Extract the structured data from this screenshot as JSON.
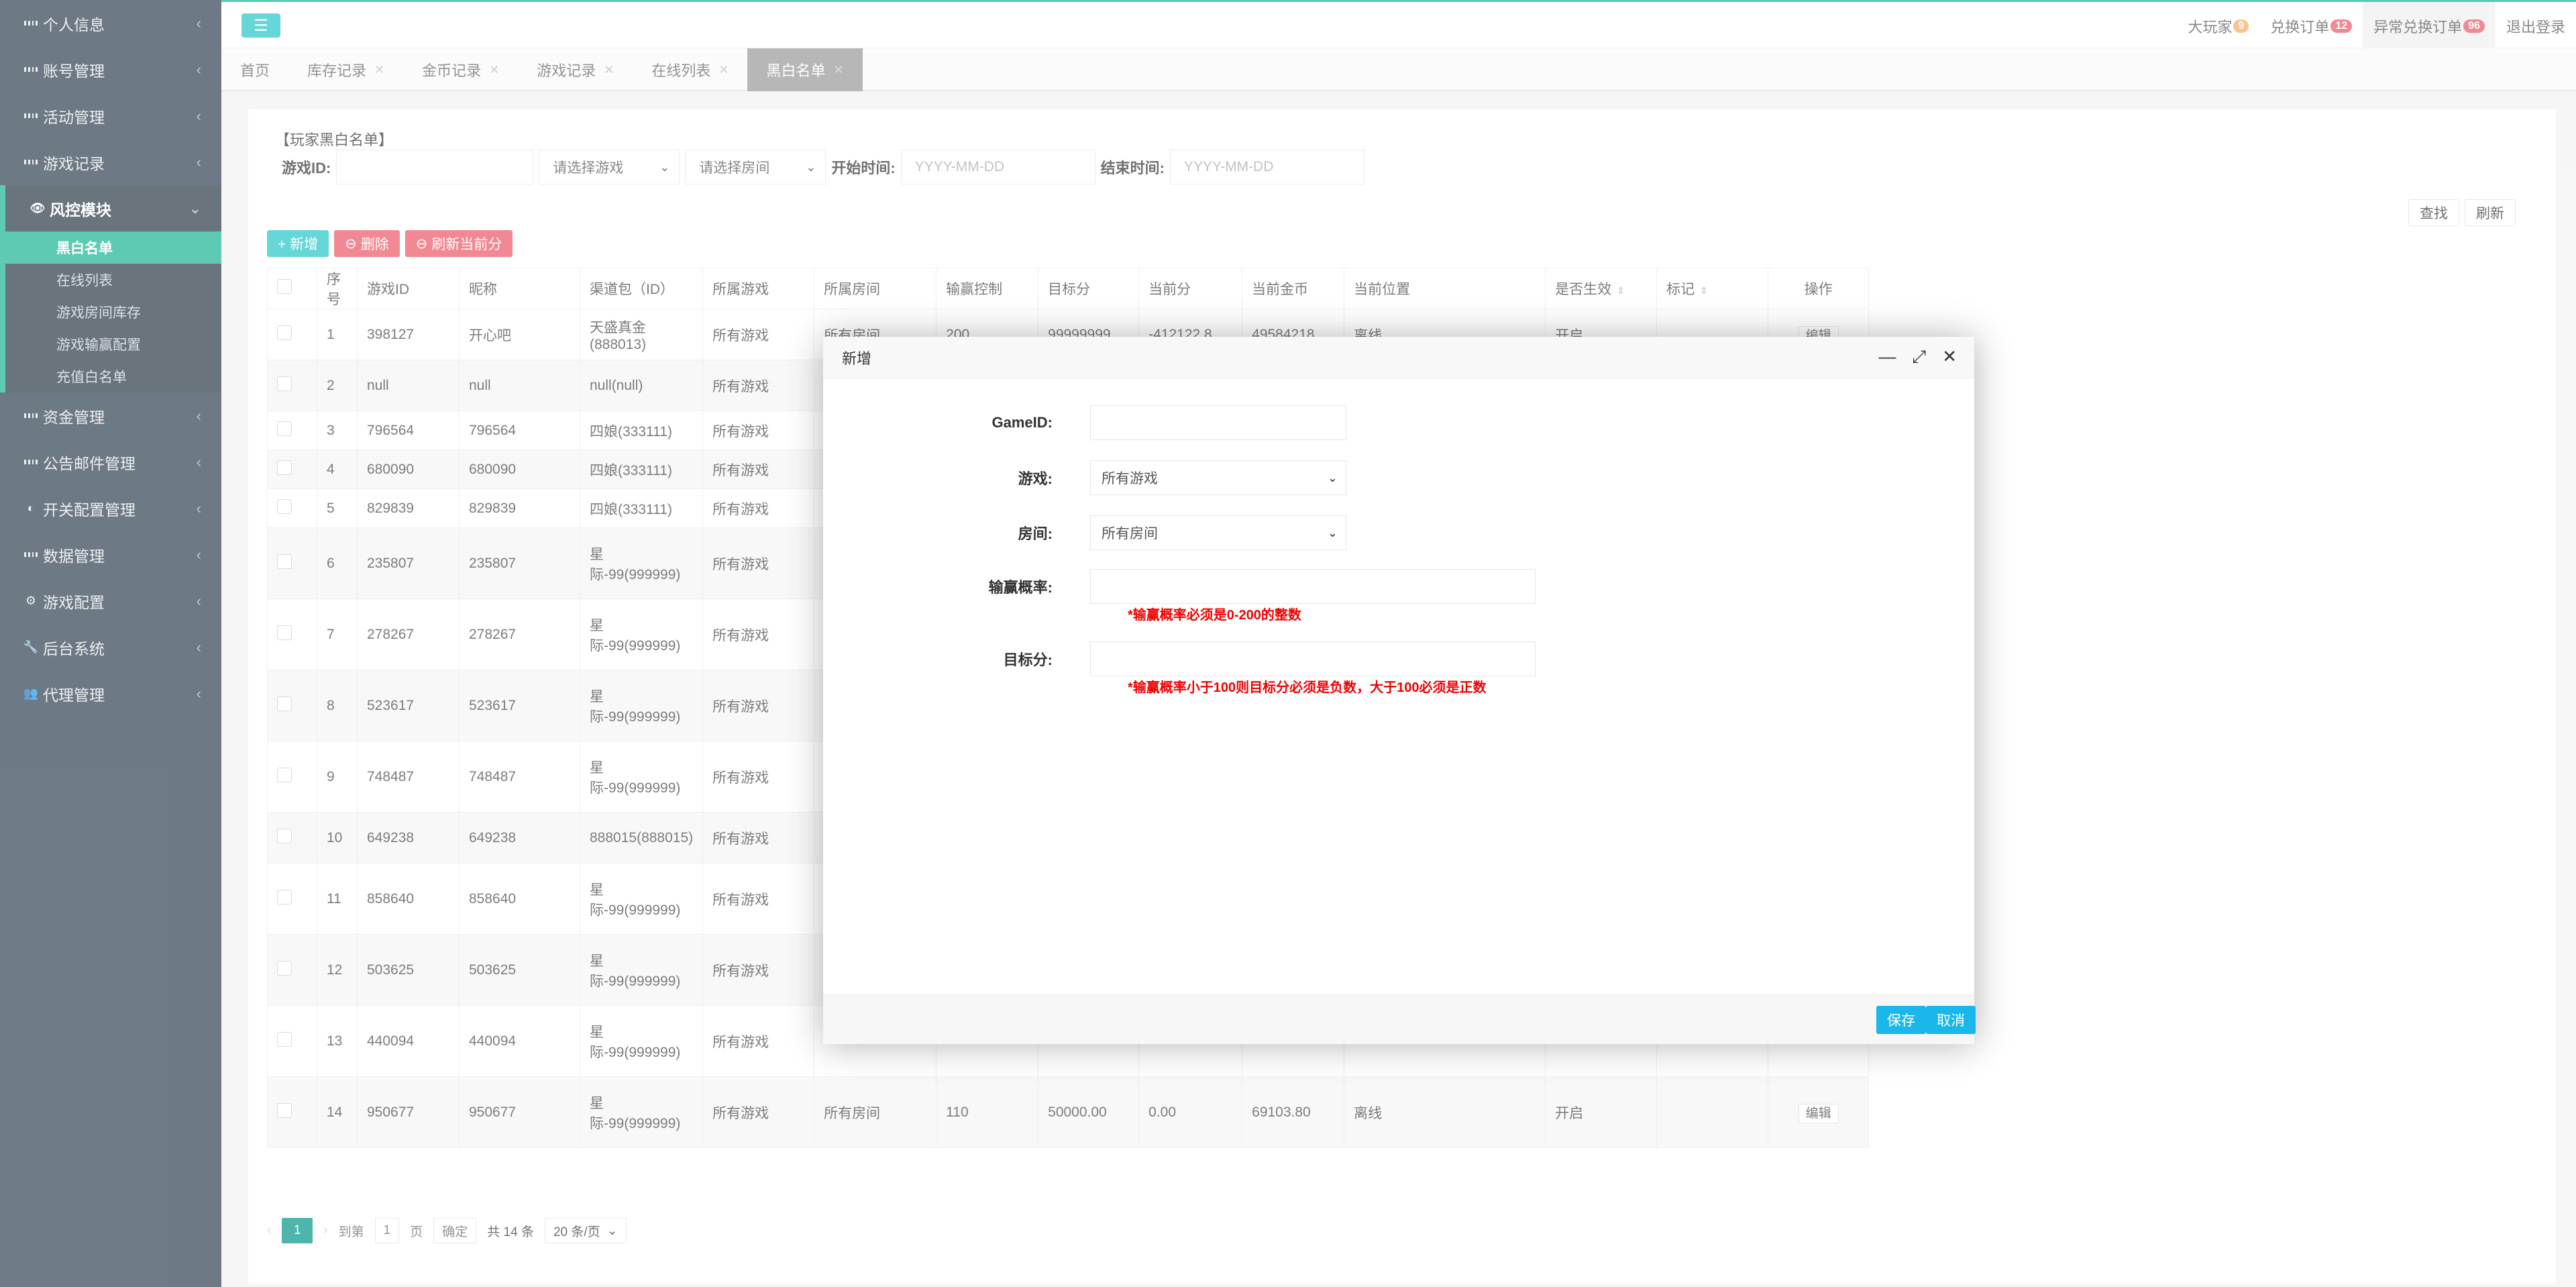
{
  "sidebar": {
    "items": [
      {
        "label": "个人信息"
      },
      {
        "label": "账号管理"
      },
      {
        "label": "活动管理"
      },
      {
        "label": "游戏记录"
      },
      {
        "label": "风控模块"
      },
      {
        "label": "资金管理"
      },
      {
        "label": "公告邮件管理"
      },
      {
        "label": "开关配置管理"
      },
      {
        "label": "数据管理"
      },
      {
        "label": "游戏配置"
      },
      {
        "label": "后台系统"
      },
      {
        "label": "代理管理"
      }
    ],
    "sub_items": [
      {
        "label": "黑白名单"
      },
      {
        "label": "在线列表"
      },
      {
        "label": "游戏房间库存"
      },
      {
        "label": "游戏输赢配置"
      },
      {
        "label": "充值白名单"
      }
    ]
  },
  "topbar": {
    "menu_icon": "☰",
    "links": [
      {
        "label": "大玩家",
        "badge": "9"
      },
      {
        "label": "兑换订单",
        "badge": "12"
      },
      {
        "label": "异常兑换订单",
        "badge": "96"
      },
      {
        "label": "退出登录"
      }
    ]
  },
  "tabs": [
    {
      "label": "首页"
    },
    {
      "label": "库存记录"
    },
    {
      "label": "金币记录"
    },
    {
      "label": "游戏记录"
    },
    {
      "label": "在线列表"
    },
    {
      "label": "黑白名单"
    }
  ],
  "panel": {
    "title": "【玩家黑白名单】",
    "filters": {
      "game_id_label": "游戏ID:",
      "game_select": "请选择游戏",
      "room_select": "请选择房间",
      "start_label": "开始时间:",
      "start_placeholder": "YYYY-MM-DD",
      "end_label": "结束时间:",
      "end_placeholder": "YYYY-MM-DD"
    },
    "search_label": "查找",
    "refresh_label": "刷新",
    "add_label": "+ 新增",
    "delete_label": "删除",
    "refresh_score_label": "刷新当前分"
  },
  "table": {
    "columns": [
      "序号",
      "游戏ID",
      "昵称",
      "渠道包（ID）",
      "所属游戏",
      "所属房间",
      "输赢控制",
      "目标分",
      "当前分",
      "当前金币",
      "当前位置",
      "是否生效",
      "标记",
      "操作"
    ],
    "rows": [
      {
        "no": "1",
        "id": "398127",
        "nick": "开心吧",
        "channel": "天盛真金(888013)",
        "game": "所有游戏",
        "room": "所有房间",
        "ctrl": "200",
        "target": "99999999",
        "score": "-412122.8",
        "gold": "49584218.",
        "pos": "离线",
        "active": "开启",
        "op": "编辑"
      },
      {
        "no": "2",
        "id": "null",
        "nick": "null",
        "channel": "null(null)",
        "game": "所有游戏"
      },
      {
        "no": "3",
        "id": "796564",
        "nick": "796564",
        "channel": "四娘(333111)",
        "game": "所有游戏"
      },
      {
        "no": "4",
        "id": "680090",
        "nick": "680090",
        "channel": "四娘(333111)",
        "game": "所有游戏"
      },
      {
        "no": "5",
        "id": "829839",
        "nick": "829839",
        "channel": "四娘(333111)",
        "game": "所有游戏"
      },
      {
        "no": "6",
        "id": "235807",
        "nick": "235807",
        "channel": "星际-99(999999)",
        "game": "所有游戏"
      },
      {
        "no": "7",
        "id": "278267",
        "nick": "278267",
        "channel": "星际-99(999999)",
        "game": "所有游戏"
      },
      {
        "no": "8",
        "id": "523617",
        "nick": "523617",
        "channel": "星际-99(999999)",
        "game": "所有游戏"
      },
      {
        "no": "9",
        "id": "748487",
        "nick": "748487",
        "channel": "星际-99(999999)",
        "game": "所有游戏"
      },
      {
        "no": "10",
        "id": "649238",
        "nick": "649238",
        "channel": "888015(888015)",
        "game": "所有游戏"
      },
      {
        "no": "11",
        "id": "858640",
        "nick": "858640",
        "channel": "星际-99(999999)",
        "game": "所有游戏"
      },
      {
        "no": "12",
        "id": "503625",
        "nick": "503625",
        "channel": "星际-99(999999)",
        "game": "所有游戏"
      },
      {
        "no": "13",
        "id": "440094",
        "nick": "440094",
        "channel": "星际-99(999999)",
        "game": "所有游戏"
      },
      {
        "no": "14",
        "id": "950677",
        "nick": "950677",
        "channel": "星际-99(999999)",
        "game": "所有游戏",
        "room": "所有房间",
        "ctrl": "110",
        "target": "50000.00",
        "score": "0.00",
        "gold": "69103.80",
        "pos": "离线",
        "active": "开启",
        "op": "编辑"
      }
    ]
  },
  "pager": {
    "current": "1",
    "goto_label": "到第",
    "goto_value": "1",
    "page_unit": "页",
    "confirm": "确定",
    "total": "共 14 条",
    "per_page": "20 条/页"
  },
  "modal": {
    "title": "新增",
    "game_id_label": "GameID:",
    "game_label": "游戏:",
    "game_value": "所有游戏",
    "room_label": "房间:",
    "room_value": "所有房间",
    "rate_label": "输赢概率:",
    "rate_hint": "*输赢概率必须是0-200的整数",
    "target_label": "目标分:",
    "target_hint": "*输赢概率小于100则目标分必须是负数，大于100必须是正数",
    "save_label": "保存",
    "cancel_label": "取消"
  },
  "colors": {
    "accent": "#1ab394",
    "sidebar": "#2f4050",
    "danger": "#ed5565",
    "info": "#23c6c8"
  }
}
